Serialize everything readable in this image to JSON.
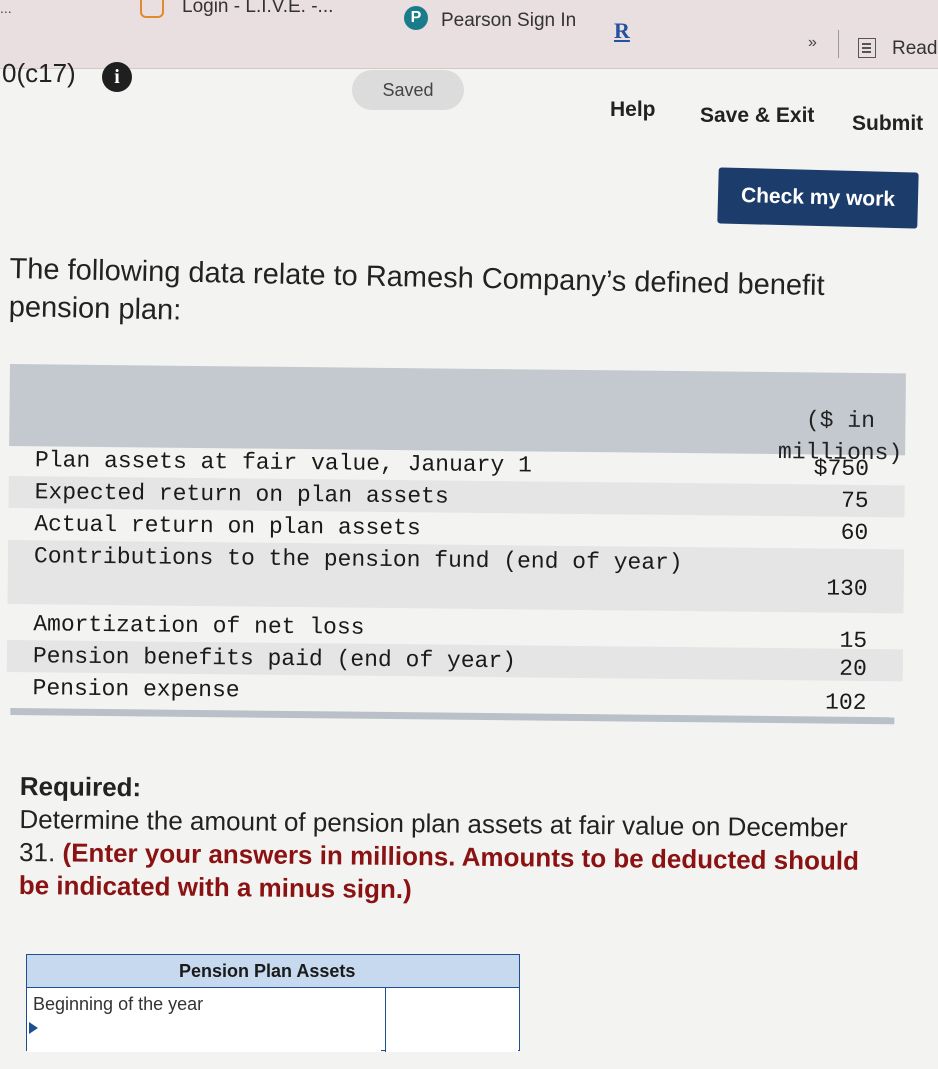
{
  "bookmarks": {
    "cut_text": "...",
    "live_label": "Login - L.I.V.E. -...",
    "pearson_label": "Pearson Sign In",
    "pearson_icon_letter": "P",
    "r_label": "R",
    "more_label": "»",
    "reader_label": "Read"
  },
  "header": {
    "problem_id": "0(c17)",
    "info_icon": "i",
    "saved_label": "Saved",
    "help_label": "Help",
    "save_exit_label": "Save & Exit",
    "submit_label": "Submit",
    "check_label": "Check my work"
  },
  "question": {
    "intro": "The following data relate to Ramesh Company’s defined benefit pension plan:",
    "column_header": "($ in\nmillions)",
    "rows": [
      {
        "label": "Plan assets at fair value, January 1",
        "value": "$750"
      },
      {
        "label": "Expected return on plan assets",
        "value": "75"
      },
      {
        "label": "Actual return on plan assets",
        "value": "60"
      },
      {
        "label": "Contributions to the pension fund (end of year)",
        "value": "130"
      },
      {
        "label": "Amortization of net loss",
        "value": "15"
      },
      {
        "label": "Pension benefits paid (end of year)",
        "value": "20"
      },
      {
        "label": "Pension expense",
        "value": "102"
      }
    ]
  },
  "required": {
    "title": "Required:",
    "text": "Determine the amount of pension plan assets at fair value on December 31.",
    "note": "(Enter your answers in millions. Amounts to be deducted should be indicated with a minus sign.)"
  },
  "answer_table": {
    "header": "Pension Plan Assets",
    "rows": [
      {
        "label": "Beginning of the year",
        "value": ""
      },
      {
        "label": "",
        "value": ""
      }
    ]
  },
  "colors": {
    "check_button": "#1c3d6b",
    "note_text": "#8b1212",
    "answer_header": "#c6d9ef",
    "answer_border": "#1f4f8f"
  }
}
